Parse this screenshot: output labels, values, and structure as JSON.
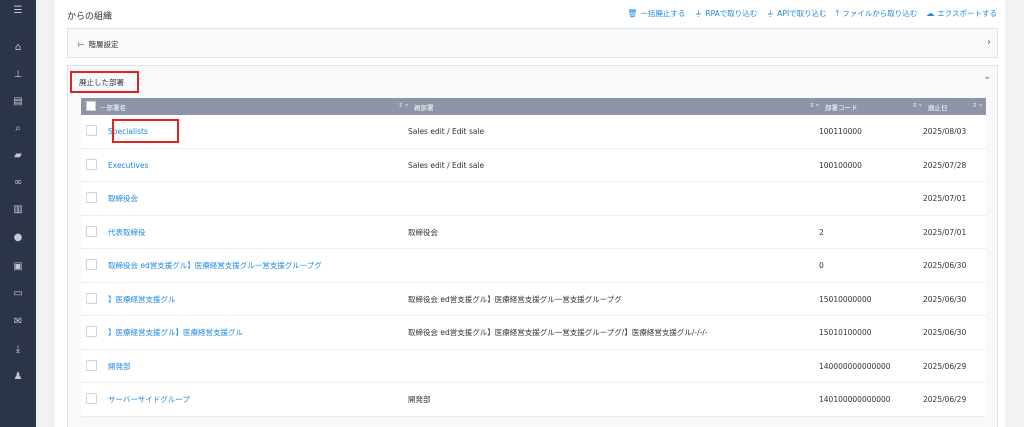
{
  "sidebar": {
    "icons": [
      "menu-icon",
      "home-icon",
      "org-chart-icon",
      "document-icon",
      "search-icon",
      "chat-icon",
      "link-icon",
      "bar-chart-icon",
      "info-icon",
      "contact-card-icon",
      "book-icon",
      "mail-icon",
      "download-icon",
      "user-settings-icon"
    ]
  },
  "page": {
    "title": "からの組織"
  },
  "actions": [
    {
      "label": "一括廃止する",
      "icon": "trash-icon"
    },
    {
      "label": "RPAで取り込む",
      "icon": "plug-icon"
    },
    {
      "label": "APIで取り込む",
      "icon": "plug-icon"
    },
    {
      "label": "ファイルから取り込む",
      "icon": "upload-icon"
    },
    {
      "label": "エクスポートする",
      "icon": "cloud-download-icon"
    }
  ],
  "panels": {
    "hierarchy": {
      "title": "階層設定"
    },
    "abolished": {
      "title": "廃止した部署"
    }
  },
  "table": {
    "columns": [
      "部署名",
      "親部署",
      "部署コード",
      "廃止日"
    ],
    "rows": [
      {
        "name": "Specialists",
        "parent": "Sales edit / Edit sale",
        "code": "100110000",
        "date": "2025/08/03"
      },
      {
        "name": "Executives",
        "parent": "Sales edit / Edit sale",
        "code": "100100000",
        "date": "2025/07/28"
      },
      {
        "name": "取締役会",
        "parent": "",
        "code": "",
        "date": "2025/07/01"
      },
      {
        "name": "代表取締役",
        "parent": "取締役会",
        "code": "2",
        "date": "2025/07/01"
      },
      {
        "name": "取締役会 ed営支援グル】医療経営支援グル一営支援グループグ",
        "parent": "",
        "code": "0",
        "date": "2025/06/30"
      },
      {
        "name": "】医療経営支援グル",
        "parent": "取締役会 ed営支援グル】医療経営支援グル一営支援グループグ",
        "code": "15010000000",
        "date": "2025/06/30"
      },
      {
        "name": "】医療経営支援グル】医療経営支援グル",
        "parent": "取締役会 ed営支援グル】医療経営支援グル一営支援グループグ/】医療経営支援グル/-/-/-",
        "code": "15010100000",
        "date": "2025/06/30"
      },
      {
        "name": "開発部",
        "parent": "",
        "code": "140000000000000",
        "date": "2025/06/29"
      },
      {
        "name": "サーバーサイドグループ",
        "parent": "開発部",
        "code": "140100000000000",
        "date": "2025/06/29"
      }
    ]
  }
}
